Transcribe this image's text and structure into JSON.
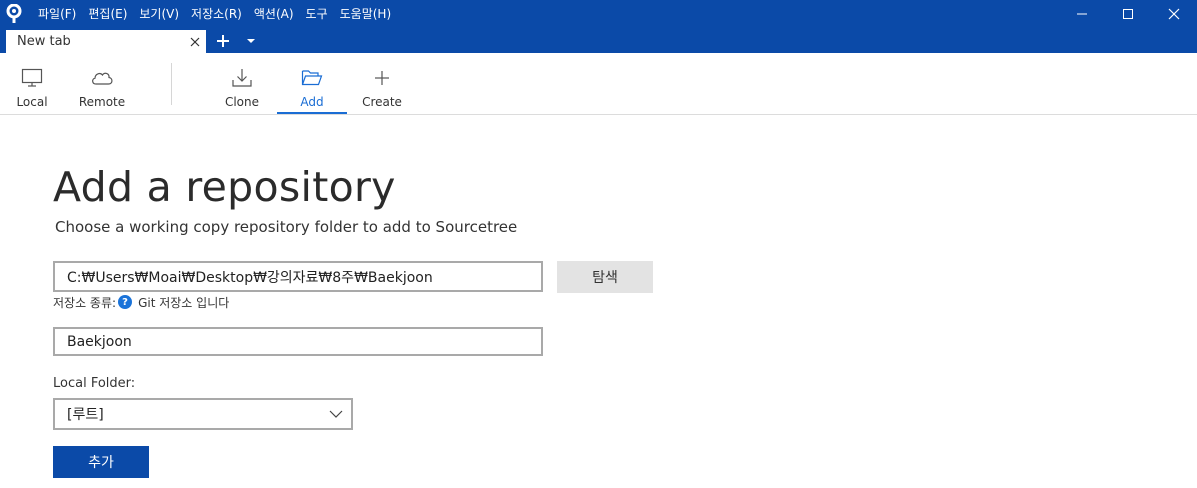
{
  "menu": {
    "items": [
      "파일(F)",
      "편집(E)",
      "보기(V)",
      "저장소(R)",
      "액션(A)",
      "도구",
      "도움말(H)"
    ]
  },
  "tabs": {
    "active_label": "New tab"
  },
  "toolbar": {
    "local_label": "Local",
    "remote_label": "Remote",
    "clone_label": "Clone",
    "add_label": "Add",
    "create_label": "Create"
  },
  "form": {
    "title": "Add a repository",
    "subtitle": "Choose a working copy repository folder to add to Sourcetree",
    "path_value": "C:₩Users₩Moai₩Desktop₩강의자료₩8주₩Baekjoon",
    "browse_label": "탐색",
    "repo_type_prefix": "저장소 종류:",
    "repo_type_value": "Git 저장소 입니다",
    "name_value": "Baekjoon",
    "local_folder_label": "Local Folder:",
    "local_folder_value": "[루트]",
    "add_button_label": "추가"
  },
  "colors": {
    "brand_blue": "#0b4aa8",
    "accent_blue": "#1a6dd4",
    "help_blue": "#1a73d9"
  },
  "icons": {
    "app": "sourcetree-logo-icon",
    "local": "monitor-icon",
    "remote": "cloud-icon",
    "clone": "download-icon",
    "add": "folder-open-icon",
    "create": "plus-icon"
  }
}
